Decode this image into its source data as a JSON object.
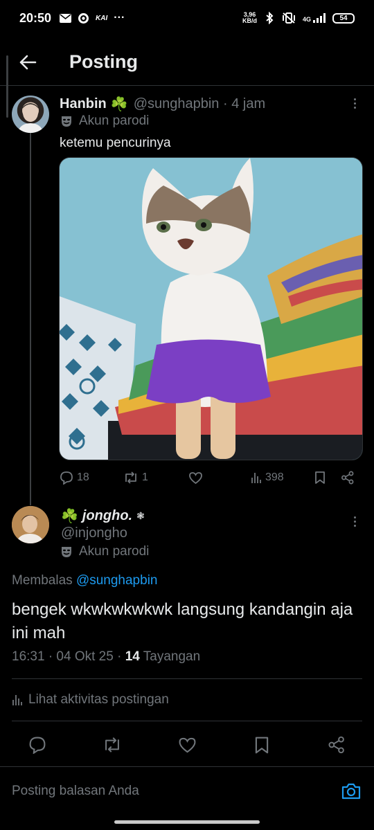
{
  "status_bar": {
    "time": "20:50",
    "app_badge": "KAI",
    "more": "···",
    "net_speed_value": "3,96",
    "net_speed_unit": "KB/d",
    "network_type": "4G",
    "battery": "54"
  },
  "header": {
    "title": "Posting"
  },
  "parent_post": {
    "author_name": "Hanbin",
    "author_emoji": "☘️",
    "handle_time": "@sunghapbin · 4 jam",
    "parody_label": "Akun parodi",
    "text": "ketemu pencurinya",
    "replies": "18",
    "reposts": "1",
    "views": "398"
  },
  "reply_post": {
    "author_emoji": "☘️",
    "author_name": "jongho.",
    "author_suffix": "❃",
    "handle": "@injongho",
    "parody_label": "Akun parodi",
    "replying_prefix": "Membalas",
    "replying_mention": "@sunghapbin",
    "text": "bengek wkwkwkwkwk langsung kandangin aja ini mah",
    "meta_prefix": "16:31 · 04 Okt 25 ·",
    "views_count": "14",
    "views_label": "Tayangan",
    "activity_label": "Lihat aktivitas postingan"
  },
  "reply_bar": {
    "placeholder": "Posting balasan Anda"
  },
  "colors": {
    "accent": "#1d9bf0",
    "muted": "#71767b",
    "text": "#e7e9ea",
    "background": "#000000"
  }
}
